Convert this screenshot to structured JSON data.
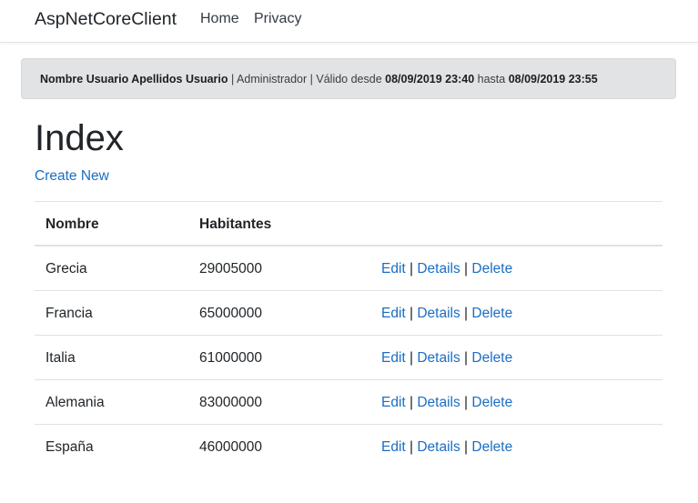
{
  "navbar": {
    "brand": "AspNetCoreClient",
    "links": [
      "Home",
      "Privacy"
    ]
  },
  "user_alert": {
    "name": "Nombre Usuario Apellidos Usuario",
    "sep1": " | ",
    "role": "Administrador",
    "sep2": " | ",
    "valid_from_label": "Válido desde ",
    "valid_from": "08/09/2019 23:40",
    "until_label": " hasta ",
    "valid_until": "08/09/2019 23:55"
  },
  "page": {
    "title": "Index",
    "create_link": "Create New"
  },
  "table": {
    "headers": [
      "Nombre",
      "Habitantes"
    ],
    "action_labels": {
      "edit": "Edit",
      "details": "Details",
      "delete": "Delete",
      "separator": " | "
    },
    "rows": [
      {
        "nombre": "Grecia",
        "habitantes": "29005000"
      },
      {
        "nombre": "Francia",
        "habitantes": "65000000"
      },
      {
        "nombre": "Italia",
        "habitantes": "61000000"
      },
      {
        "nombre": "Alemania",
        "habitantes": "83000000"
      },
      {
        "nombre": "España",
        "habitantes": "46000000"
      }
    ]
  },
  "colors": {
    "link": "#1b6ec2",
    "alert_bg": "#e2e3e5",
    "text": "#212529"
  }
}
